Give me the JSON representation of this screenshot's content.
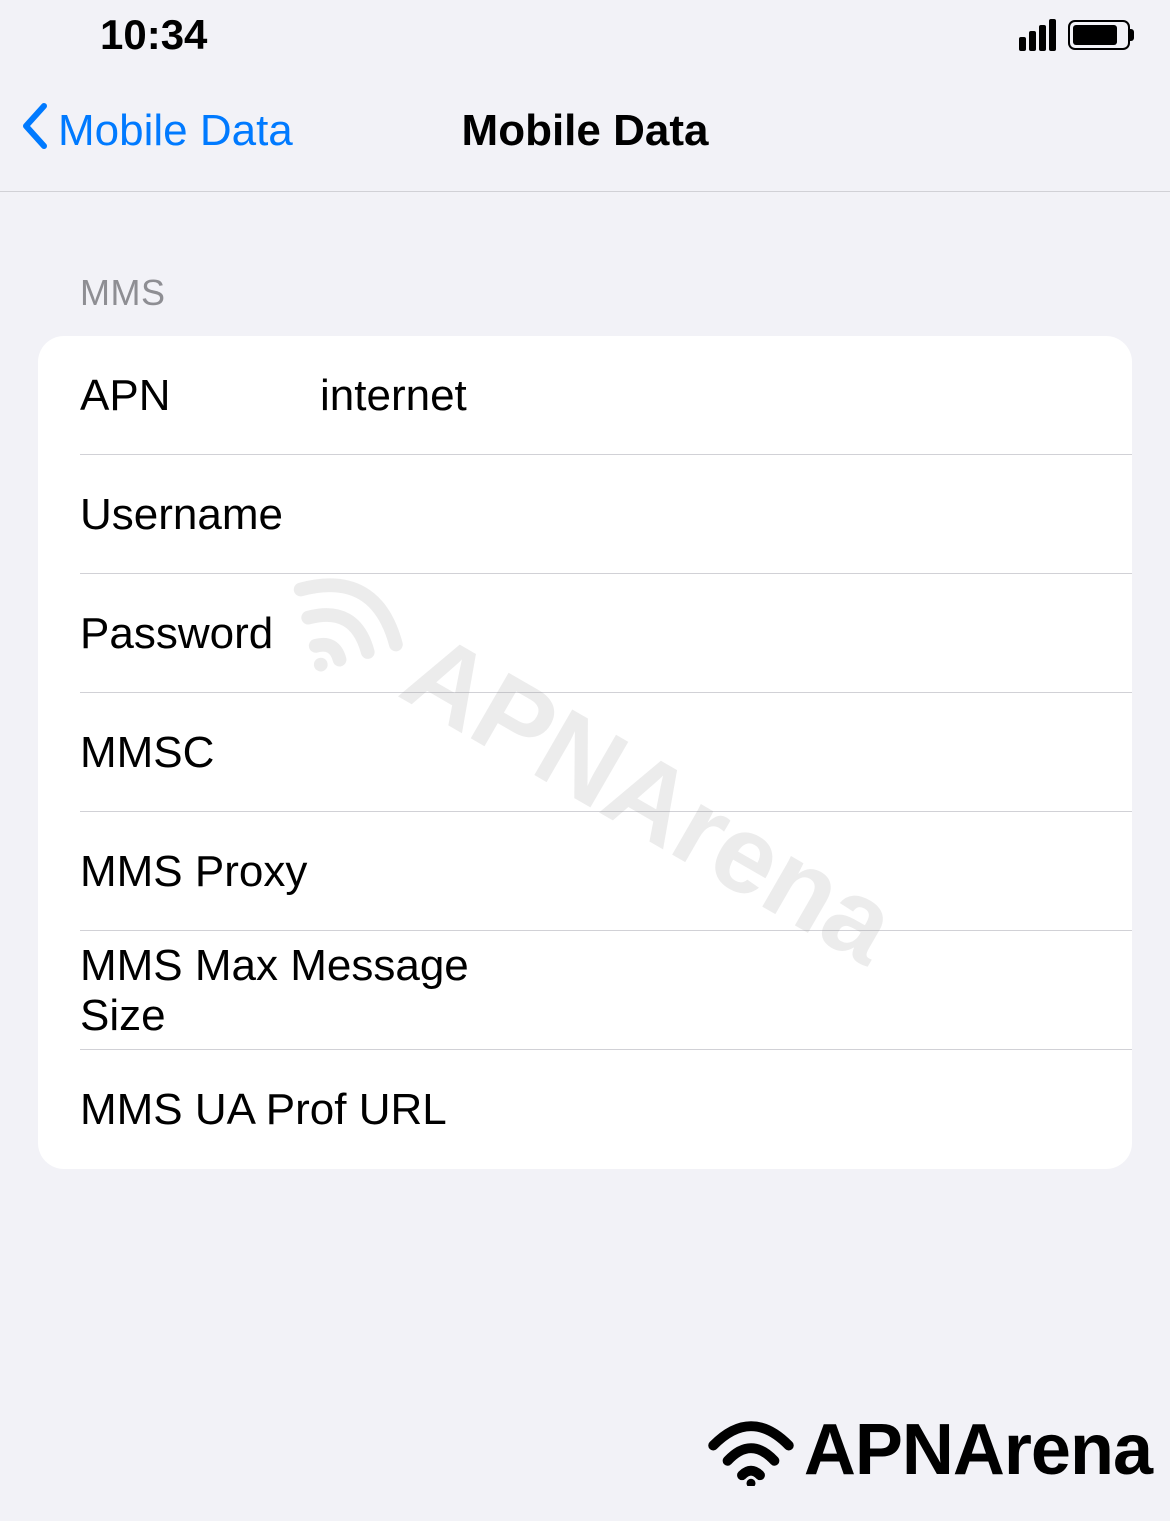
{
  "statusBar": {
    "time": "10:34"
  },
  "navBar": {
    "backLabel": "Mobile Data",
    "title": "Mobile Data"
  },
  "section": {
    "header": "MMS",
    "rows": [
      {
        "label": "APN",
        "value": "internet"
      },
      {
        "label": "Username",
        "value": ""
      },
      {
        "label": "Password",
        "value": ""
      },
      {
        "label": "MMSC",
        "value": ""
      },
      {
        "label": "MMS Proxy",
        "value": ""
      },
      {
        "label": "MMS Max Message Size",
        "value": ""
      },
      {
        "label": "MMS UA Prof URL",
        "value": ""
      }
    ]
  },
  "watermark": "APNArena",
  "brand": "APNArena"
}
